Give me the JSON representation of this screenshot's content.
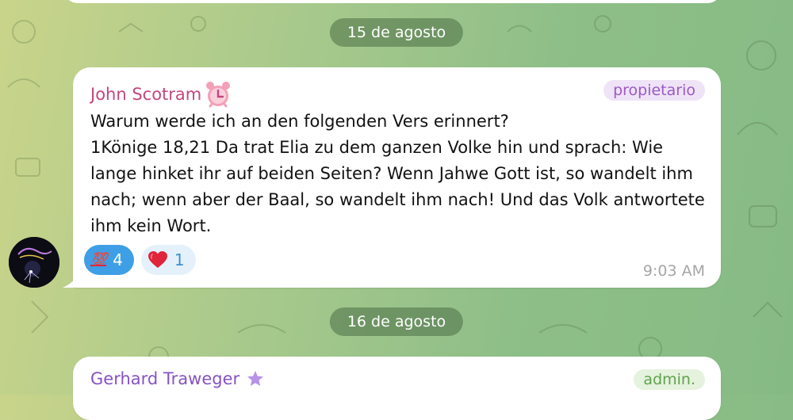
{
  "dates": [
    "15 de agosto",
    "16 de agosto"
  ],
  "messages": [
    {
      "sender": "John Scotram",
      "sender_icon": "alarm-clock-icon",
      "role": "propietario",
      "text": "Warum werde ich an den folgenden Vers erinnert?\n1Könige 18,21 Da trat Elia zu dem ganzen Volke hin und sprach: Wie lange hinket ihr auf beiden Seiten? Wenn Jahwe Gott ist, so wandelt ihm nach; wenn aber der Baal, so wandelt ihm nach! Und das Volk antwortete ihm kein Wort.",
      "reactions": [
        {
          "emoji": "💯",
          "emoji_name": "hundred-points-icon",
          "count": "4"
        },
        {
          "emoji": "❤️",
          "emoji_name": "heart-icon",
          "count": "1"
        }
      ],
      "time": "9:03 AM"
    },
    {
      "sender": "Gerhard Traweger",
      "sender_icon": "star-icon",
      "role": "admin."
    }
  ],
  "colors": {
    "owner_name": "#c4467f",
    "admin_name": "#8553c4",
    "reaction_active": "#3e9fe6",
    "heart": "#e0243a"
  }
}
